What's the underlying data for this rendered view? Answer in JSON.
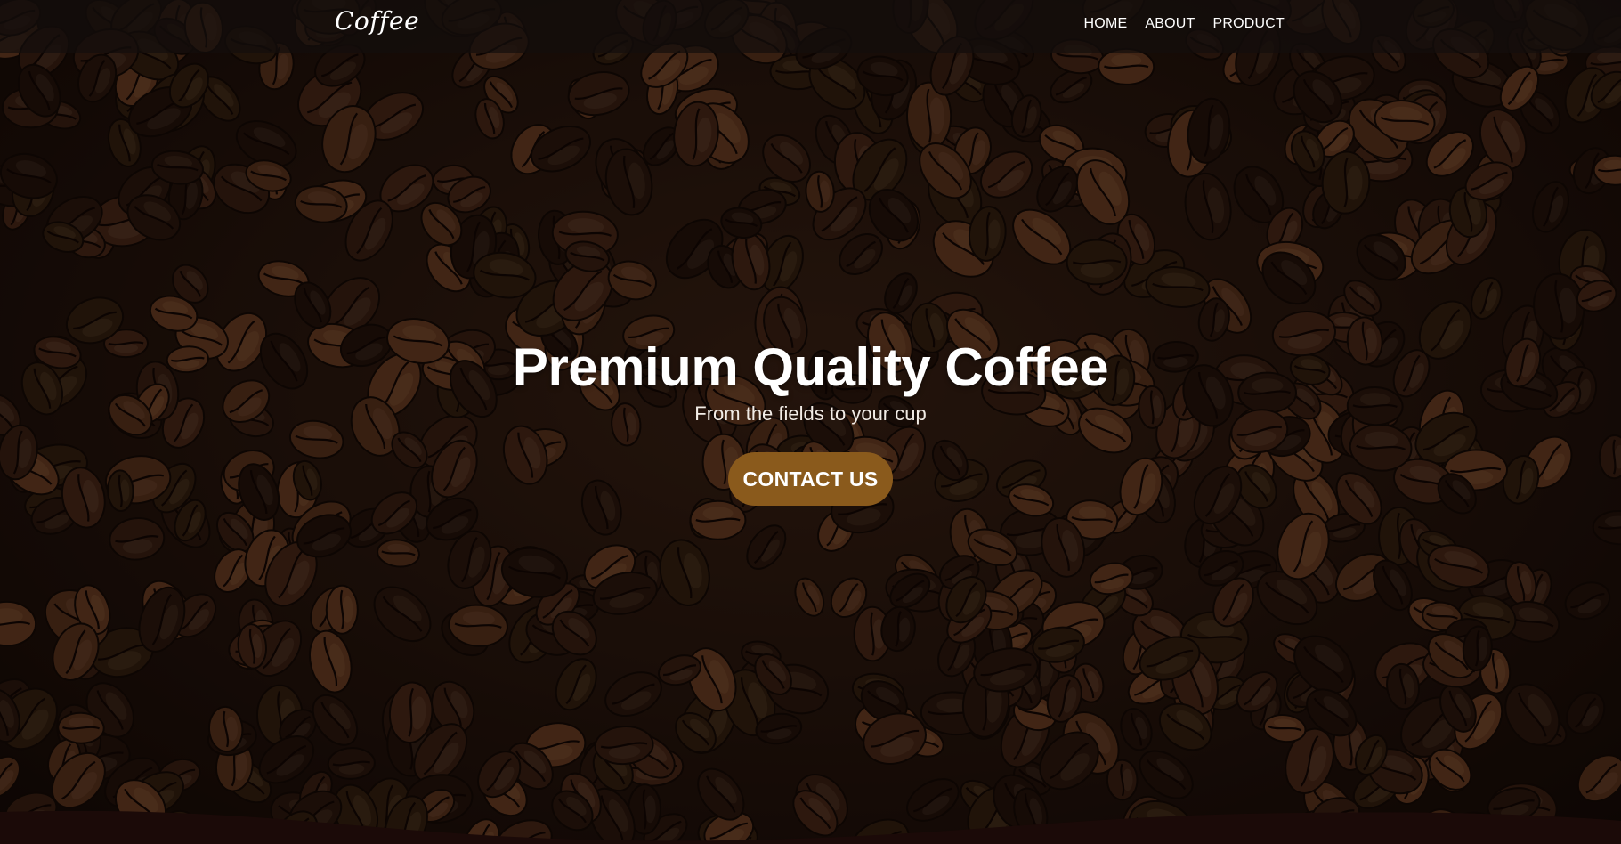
{
  "navbar": {
    "brand": "Coffee",
    "links": [
      "HOME",
      "ABOUT",
      "PRODUCT"
    ]
  },
  "hero": {
    "title": "Premium Quality Coffee",
    "subtitle": "From the fields to your cup",
    "cta_label": "CONTACT US"
  },
  "colors": {
    "accent": "#8a5a1c",
    "navbar_bg": "#140e0c",
    "footer_wave": "#1b0a08"
  },
  "background": {
    "image_subject": "roasted coffee beans"
  }
}
